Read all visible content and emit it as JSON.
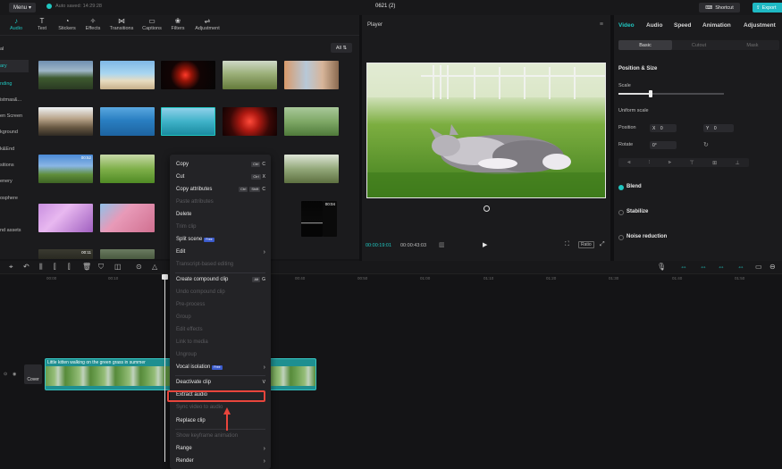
{
  "topbar": {
    "menu_label": "Menu",
    "autosave": "Auto saved: 14:29:28",
    "title": "0621 (2)",
    "shortcut_label": "Shortcut",
    "export_label": "Export"
  },
  "toolbar": {
    "tabs": [
      {
        "icon": "audio-icon",
        "label": "Audio"
      },
      {
        "icon": "text-icon",
        "label": "Text"
      },
      {
        "icon": "stickers-icon",
        "label": "Stickers"
      },
      {
        "icon": "effects-icon",
        "label": "Effects"
      },
      {
        "icon": "transitions-icon",
        "label": "Transitions"
      },
      {
        "icon": "captions-icon",
        "label": "Captions"
      },
      {
        "icon": "filters-icon",
        "label": "Filters"
      },
      {
        "icon": "adjustment-icon",
        "label": "Adjustment"
      }
    ]
  },
  "sidebar": {
    "categories": [
      {
        "label": "al"
      },
      {
        "label": "ary"
      },
      {
        "label": "nding"
      },
      {
        "label": "istmas&..."
      },
      {
        "label": "en Screen"
      },
      {
        "label": "kground"
      },
      {
        "label": "k&End"
      },
      {
        "label": "sitions"
      },
      {
        "label": "enery"
      },
      {
        "label": "osphere"
      },
      {
        "label": "nd assets"
      }
    ]
  },
  "media": {
    "filter_label": "All",
    "durations": [
      "00:52",
      "00:04",
      "00:11"
    ]
  },
  "player": {
    "title": "Player",
    "time_current": "00:00:19:01",
    "time_total": "00:00:43:03",
    "ratio_label": "Ratio"
  },
  "props": {
    "tabs": [
      "Video",
      "Audio",
      "Speed",
      "Animation",
      "Adjustment"
    ],
    "subtabs": [
      "Basic",
      "Cutout",
      "Mask"
    ],
    "position_size": "Position & Size",
    "scale": "Scale",
    "uniform_scale": "Uniform scale",
    "position": "Position",
    "pos_x_label": "X",
    "pos_x": "0",
    "pos_y_label": "Y",
    "pos_y": "0",
    "rotate": "Rotate",
    "rotate_value": "0°",
    "blend": "Blend",
    "stabilize": "Stabilize",
    "noise_reduction": "Noise reduction"
  },
  "timeline": {
    "ruler": [
      "00:00",
      "00:10",
      "00:20",
      "00:30",
      "00:40",
      "00:50",
      "01:00",
      "01:10",
      "01:20",
      "01:30",
      "01:40",
      "01:50"
    ],
    "clip_title": "Little kitten walking on the green grass in summer",
    "cover_label": "Cover"
  },
  "context_menu": {
    "items": [
      {
        "label": "Copy",
        "keys": [
          "Ctrl",
          "C"
        ]
      },
      {
        "label": "Cut",
        "keys": [
          "Ctrl",
          "X"
        ]
      },
      {
        "label": "Copy attributes",
        "keys": [
          "Ctrl",
          "Shift",
          "C"
        ]
      },
      {
        "label": "Paste attributes"
      },
      {
        "label": "Delete"
      },
      {
        "label": "Trim clip"
      },
      {
        "label": "Split scene",
        "badge": "Free"
      },
      {
        "label": "Edit"
      },
      {
        "label": "Transcript-based editing"
      },
      {
        "label": "Create compound clip",
        "keys": [
          "Alt",
          "G"
        ]
      },
      {
        "label": "Undo compound clip"
      },
      {
        "label": "Pre-process"
      },
      {
        "label": "Group"
      },
      {
        "label": "Edit effects"
      },
      {
        "label": "Link to media"
      },
      {
        "label": "Ungroup"
      },
      {
        "label": "Vocal isolation",
        "badge": "Free"
      },
      {
        "label": "Deactivate clip",
        "keys": [
          "V"
        ]
      },
      {
        "label": "Extract audio"
      },
      {
        "label": "Sync video to audio"
      },
      {
        "label": "Replace clip"
      },
      {
        "label": "Show keyframe animation"
      },
      {
        "label": "Range"
      },
      {
        "label": "Render"
      }
    ]
  },
  "colors": {
    "accent": "#20c6c0",
    "highlight": "#e8453c"
  }
}
